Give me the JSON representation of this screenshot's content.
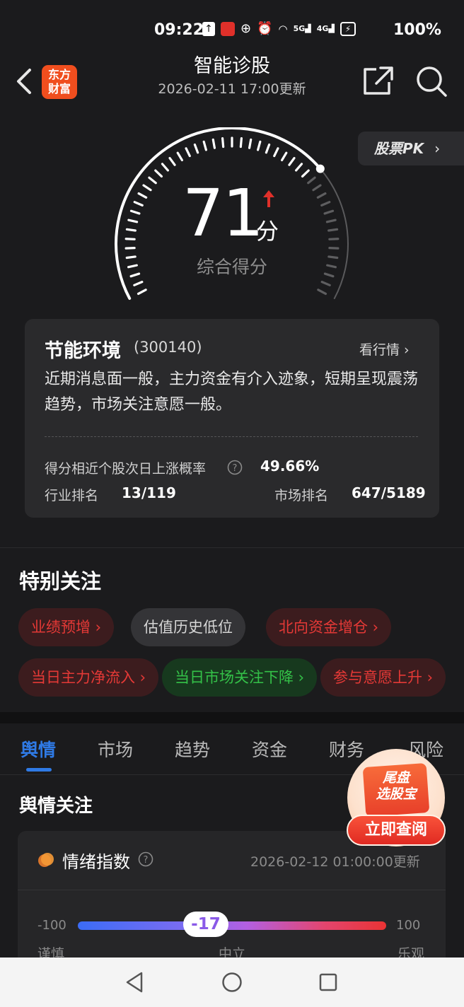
{
  "status_bar": {
    "time": "09:22",
    "battery": "100%",
    "icons": [
      "upload-icon",
      "app-notification-icon",
      "nfc-icon",
      "alarm-icon",
      "wifi-icon",
      "5g-signal-icon",
      "4g-signal-icon",
      "battery-icon"
    ],
    "signal_5g": "5G",
    "signal_4g": "4G"
  },
  "header": {
    "title": "智能诊股",
    "updated": "2026-02-11 17:00更新",
    "logo_line1": "东方",
    "logo_line2": "财富",
    "logo_color": "#f04e1e"
  },
  "pk_button": {
    "label": "股票PK"
  },
  "score": {
    "value": "71",
    "unit": "分",
    "label": "综合得分",
    "trend": "up",
    "level": 0.71
  },
  "stock": {
    "name": "节能环境",
    "code": "(300140)",
    "view_quote": "看行情",
    "description": "近期消息面一般，主力资金有介入迹象，短期呈现震荡趋势，市场关注意愿一般。",
    "prob_label": "得分相近个股次日上涨概率",
    "prob_value": "49.66%",
    "industry_label": "行业排名",
    "industry_value": "13/119",
    "market_label": "市场排名",
    "market_value": "647/5189"
  },
  "special": {
    "title": "特别关注",
    "tags": [
      {
        "label": "业绩预增",
        "style": "red",
        "arrow": true
      },
      {
        "label": "估值历史低位",
        "style": "gray",
        "arrow": false
      },
      {
        "label": "北向资金增仓",
        "style": "red",
        "arrow": true
      },
      {
        "label": "当日主力净流入",
        "style": "red",
        "arrow": true
      },
      {
        "label": "当日市场关注下降",
        "style": "green",
        "arrow": true
      },
      {
        "label": "参与意愿上升",
        "style": "red",
        "arrow": true
      }
    ]
  },
  "tabs": [
    {
      "label": "舆情",
      "active": true
    },
    {
      "label": "市场",
      "active": false
    },
    {
      "label": "趋势",
      "active": false
    },
    {
      "label": "资金",
      "active": false
    },
    {
      "label": "财务",
      "active": false
    },
    {
      "label": "风险",
      "active": false
    }
  ],
  "sentiment": {
    "section_title": "舆情关注",
    "card_title": "情绪指数",
    "updated": "2026-02-12 01:00:00更新",
    "min": "-100",
    "max": "100",
    "value": "-17",
    "value_num": -17,
    "label_left": "谨慎",
    "label_mid": "中立",
    "label_right": "乐观"
  },
  "promo": {
    "line1": "尾盘",
    "line2": "选股宝",
    "button": "立即查阅"
  },
  "colors": {
    "accent_blue": "#2f7ae5",
    "rise_red": "#e53936",
    "fall_green": "#34c148",
    "background": "#1b1b1d"
  }
}
